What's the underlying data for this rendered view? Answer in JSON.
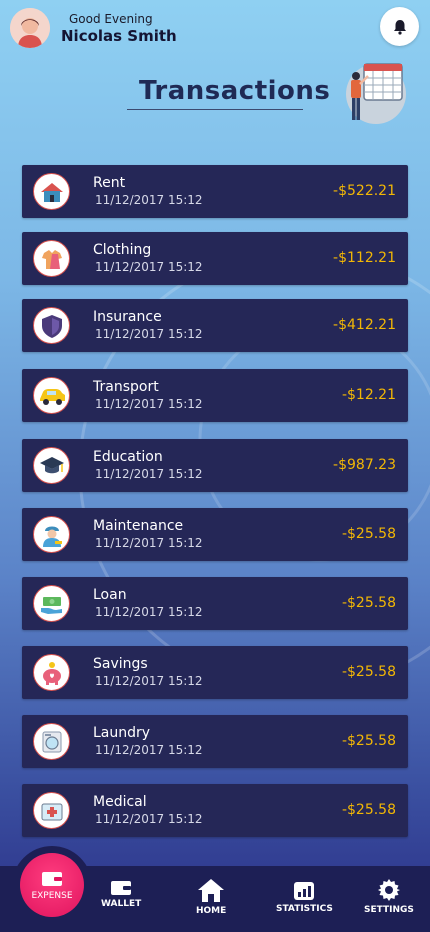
{
  "header": {
    "greeting": "Good Evening",
    "user_name": "Nicolas Smith"
  },
  "page_title": "Transactions",
  "transactions": [
    {
      "category": "Rent",
      "datetime": "11/12/2017 15:12",
      "amount": "-$522.21",
      "icon": "house-icon"
    },
    {
      "category": "Clothing",
      "datetime": "11/12/2017 15:12",
      "amount": "-$112.21",
      "icon": "clothing-icon"
    },
    {
      "category": "Insurance",
      "datetime": "11/12/2017 15:12",
      "amount": "-$412.21",
      "icon": "shield-icon"
    },
    {
      "category": "Transport",
      "datetime": "11/12/2017 15:12",
      "amount": "-$12.21",
      "icon": "car-icon"
    },
    {
      "category": "Education",
      "datetime": "11/12/2017 15:12",
      "amount": "-$987.23",
      "icon": "graduation-cap-icon"
    },
    {
      "category": "Maintenance",
      "datetime": "11/12/2017 15:12",
      "amount": "-$25.58",
      "icon": "worker-icon"
    },
    {
      "category": "Loan",
      "datetime": "11/12/2017 15:12",
      "amount": "-$25.58",
      "icon": "money-hand-icon"
    },
    {
      "category": "Savings",
      "datetime": "11/12/2017 15:12",
      "amount": "-$25.58",
      "icon": "piggy-bank-icon"
    },
    {
      "category": "Laundry",
      "datetime": "11/12/2017 15:12",
      "amount": "-$25.58",
      "icon": "washing-machine-icon"
    },
    {
      "category": "Medical",
      "datetime": "11/12/2017 15:12",
      "amount": "-$25.58",
      "icon": "medical-kit-icon"
    }
  ],
  "bottom_nav": {
    "expense": "EXPENSE",
    "wallet": "WALLET",
    "home": "HOME",
    "statistics": "STATISTICS",
    "settings": "SETTINGS"
  },
  "colors": {
    "card_bg": "#252757",
    "amount": "#f2b705",
    "fab": "#e0145e",
    "nav_bg": "#1d1f55"
  }
}
